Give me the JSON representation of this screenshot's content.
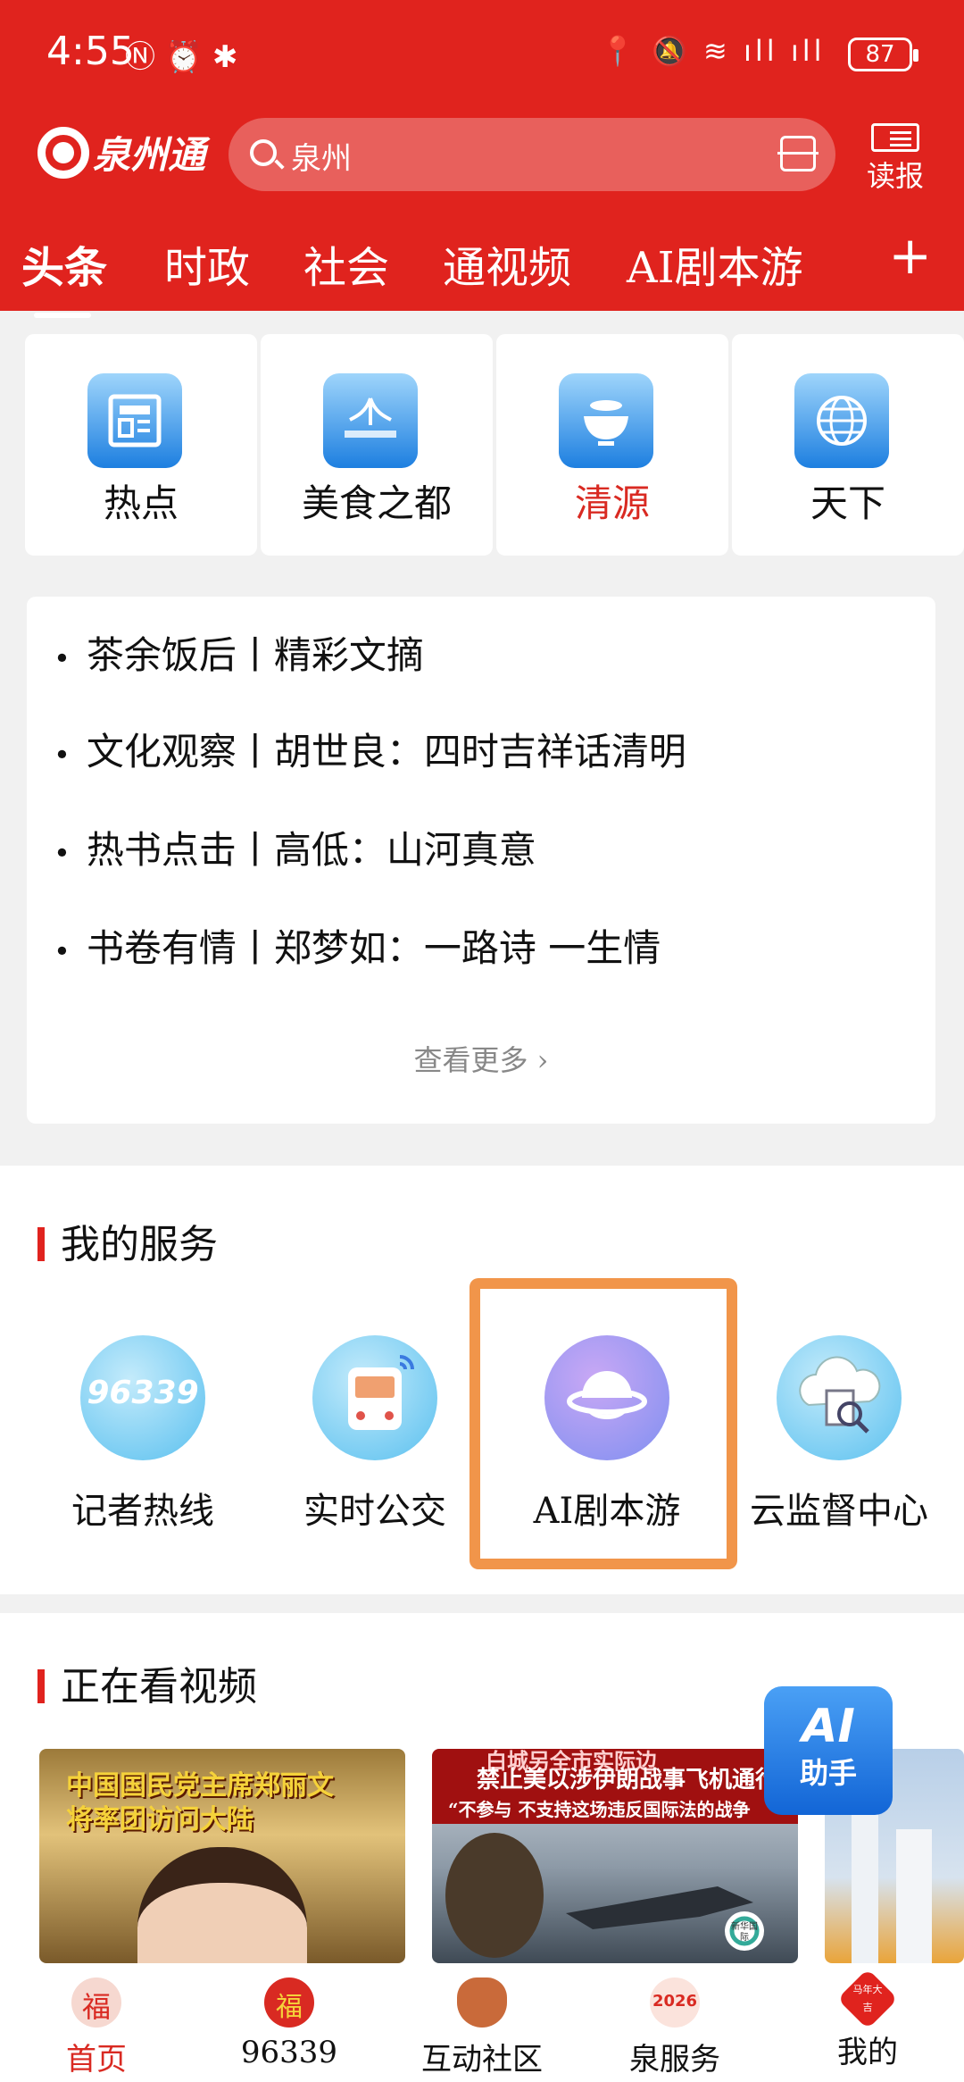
{
  "status_bar": {
    "time": "4:55",
    "battery": "87"
  },
  "header": {
    "logo_text": "泉州通",
    "search_placeholder": "泉州",
    "read_paper_label": "读报"
  },
  "tabs": [
    "头条",
    "时政",
    "社会",
    "通视频",
    "AI剧本游"
  ],
  "channels": [
    {
      "label": "热点",
      "icon": "newspaper-icon"
    },
    {
      "label": "美食之都",
      "icon": "quanzhou-logo-icon"
    },
    {
      "label": "清源",
      "icon": "tea-bowl-icon"
    },
    {
      "label": "天下",
      "icon": "globe-icon"
    }
  ],
  "articles": [
    "茶余饭后丨精彩文摘",
    "文化观察丨胡世良：四时吉祥话清明",
    "热书点击丨高低：山河真意",
    "书卷有情丨郑梦如：一路诗  一生情"
  ],
  "articles_more": "查看更多 ›",
  "services": {
    "title": "我的服务",
    "items": [
      {
        "label": "记者热线",
        "icon_text": "96339"
      },
      {
        "label": "实时公交",
        "icon": "bus-icon"
      },
      {
        "label": "AI剧本游",
        "icon": "planet-icon"
      },
      {
        "label": "云监督中心",
        "icon": "cloud-search-icon"
      }
    ]
  },
  "video": {
    "title": "正在看视频",
    "thumb1_caption_1": "中国国民党主席郑丽文",
    "thumb1_caption_2": "将率团访问大陆",
    "thumb2_caption_top": "白城另全市实际边",
    "thumb2_caption_1": "禁止美以涉伊朗战事飞机通行",
    "thumb2_caption_2": "“不参与 不支持这场违反国际法的战争",
    "thumb2_logo": "新华国际"
  },
  "ai_helper": {
    "line1": "AI",
    "line2": "助手"
  },
  "bottom_nav": [
    {
      "label": "首页",
      "badge": "福"
    },
    {
      "label": "96339",
      "badge": "福"
    },
    {
      "label": "互动社区",
      "badge": ""
    },
    {
      "label": "泉服务",
      "badge": "2026"
    },
    {
      "label": "我的",
      "badge": "马年大吉"
    }
  ],
  "colors": {
    "brand_red": "#e0231e",
    "highlight_orange": "#f1954a"
  }
}
